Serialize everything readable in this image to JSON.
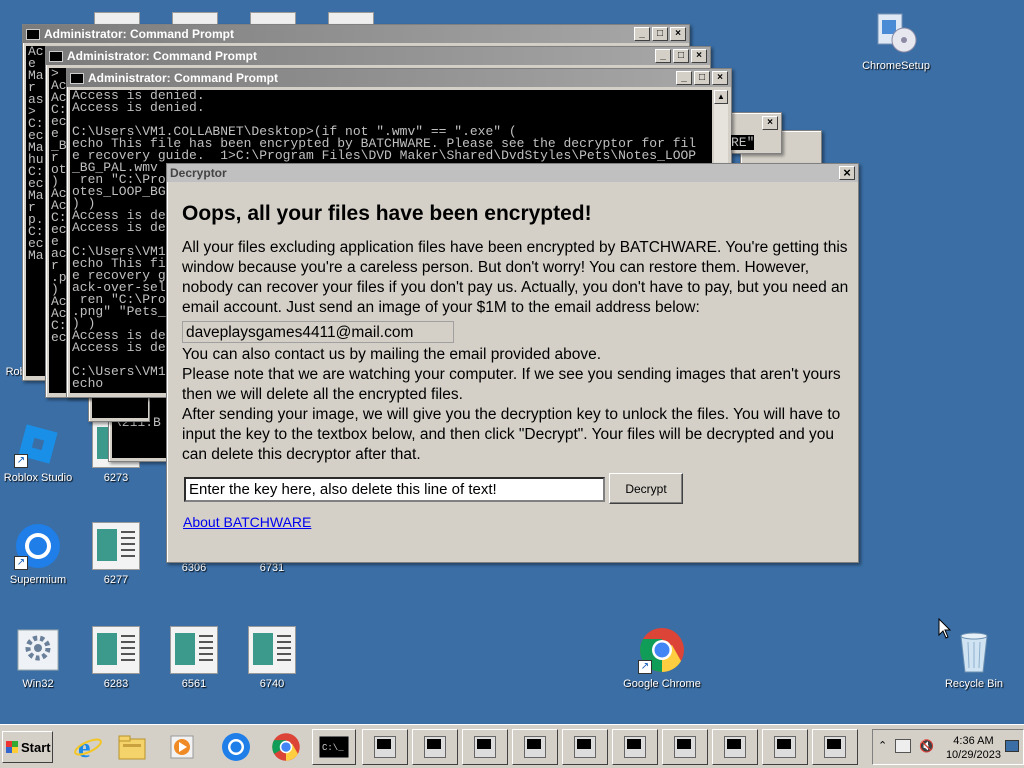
{
  "desktop": {
    "icons": [
      {
        "label": "ChromeSetup",
        "kind": "setup"
      },
      {
        "label": "Roblox Studio",
        "kind": "roblox"
      },
      {
        "label": "Supermium",
        "kind": "supermium"
      },
      {
        "label": "Win32",
        "kind": "gear"
      },
      {
        "label": "6273",
        "kind": "doc"
      },
      {
        "label": "6277",
        "kind": "doc"
      },
      {
        "label": "6306",
        "kind": "doc"
      },
      {
        "label": "6731",
        "kind": "doc"
      },
      {
        "label": "6283",
        "kind": "doc"
      },
      {
        "label": "6561",
        "kind": "doc"
      },
      {
        "label": "6740",
        "kind": "doc"
      },
      {
        "label": "Google Chrome",
        "kind": "chrome"
      },
      {
        "label": "Recycle Bin",
        "kind": "recycle"
      },
      {
        "label": "Roblox Playe",
        "kind": "roblox"
      }
    ]
  },
  "cmd_windows": {
    "title": "Administrator: Command Prompt",
    "front_lines": [
      "Access is denied.",
      "Access is denied.",
      "",
      "C:\\Users\\VM1.COLLABNET\\Desktop>(if not \".wmv\" == \".exe\" (",
      "echo This file has been encrypted by BATCHWARE. Please see the decryptor for fil",
      "e recovery guide.  1>C:\\Program Files\\DVD Maker\\Shared\\DvdStyles\\Pets\\Notes_LOOP",
      "_BG_PAL.wmv",
      " ren \"C:\\Pro",
      "otes_LOOP_BG",
      ") )",
      "Access is de",
      "Access is de",
      "",
      "C:\\Users\\VM1",
      "echo This fi",
      "e recovery g",
      "ack-over-sel",
      " ren \"C:\\Pro",
      ".png\" \"Pets_",
      ") )",
      "Access is de",
      "Access is de",
      "",
      "C:\\Users\\VM1",
      "echo"
    ],
    "back_fragments": [
      "Ac",
      "e",
      "Ma",
      "r",
      "as",
      ">",
      "C:",
      "ec",
      "Ma",
      "hu",
      "C:",
      "ec",
      "Ma",
      "r",
      "p.",
      "C:",
      "ec",
      "Ma"
    ],
    "mid_fragments": [
      ">",
      "Ac",
      "Ac",
      "C:",
      "ec",
      "e",
      "_B",
      "r",
      "ot",
      ")",
      "Ac",
      "Ac",
      "C:",
      "ec",
      "e",
      "ac",
      "r",
      ".p",
      ")",
      "Ac",
      "Ac",
      "C:",
      "ec"
    ],
    "lower_fragments": [
      "C:",
      "\\211.B",
      "cu"
    ],
    "right_fragment": "RE\""
  },
  "decryptor": {
    "title": "Decryptor",
    "heading": "Oops, all your files have been encrypted!",
    "paragraph1": "All your files excluding application files have been encrypted by BATCHWARE. You're getting this window because you're a careless person. But don't worry! You can restore them. However, nobody can recover your files if you don't pay us. Actually, you don't have to pay, but you need an email account. Just send an image of your $1M to the email address below:",
    "email": "daveplaysgames4411@mail.com",
    "paragraph2": "You can also contact us by mailing the email provided above.",
    "paragraph3": "Please note that we are watching your computer. If we see you sending images that aren't yours then we will delete all the encrypted files.",
    "paragraph4": "After sending your image, we will give you the decryption key to unlock the files. You will have to input the key to the textbox below, and then click \"Decrypt\". Your files will be decrypted and you can delete this decryptor after that.",
    "key_value": "Enter the key here, also delete this line of text!",
    "decrypt_label": "Decrypt",
    "about_link": "About BATCHWARE",
    "close_label": "×"
  },
  "taskbar": {
    "start_label": "Start",
    "time": "4:36 AM",
    "date": "10/29/2023",
    "pinned": [
      "internet-explorer",
      "file-explorer",
      "media-player",
      "supermium",
      "chrome",
      "command-prompt"
    ],
    "task_count": 10
  }
}
